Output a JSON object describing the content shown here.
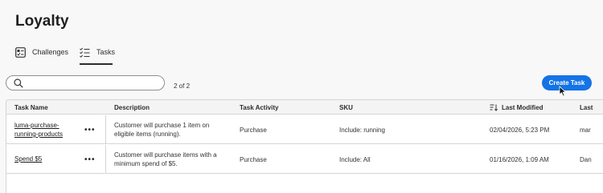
{
  "page_title": "Loyalty",
  "tabs": [
    {
      "label": "Challenges",
      "icon": "challenges-icon",
      "selected": false
    },
    {
      "label": "Tasks",
      "icon": "list-checks-icon",
      "selected": true
    }
  ],
  "search": {
    "value": "",
    "placeholder": ""
  },
  "result_count": "2 of 2",
  "create_button": "Create Task",
  "table": {
    "columns": [
      "Task Name",
      "Description",
      "Task Activity",
      "SKU",
      "Last Modified",
      "Last"
    ],
    "sorted_column": "Last Modified",
    "rows": [
      {
        "name": "luma-purchase-running-products",
        "description": "Customer will purchase 1 item on eligible items (running).",
        "activity": "Purchase",
        "sku": "Include: running",
        "modified": "02/04/2026, 5:23 PM",
        "last": "mar"
      },
      {
        "name": "Spend $5",
        "description": "Customer will purchase items with a minimum spend of $5.",
        "activity": "Purchase",
        "sku": "Include: All",
        "modified": "01/16/2026, 1:09 AM",
        "last": "Dan"
      }
    ]
  },
  "colors": {
    "accent": "#1473e6",
    "background": "#f8f8f8"
  }
}
